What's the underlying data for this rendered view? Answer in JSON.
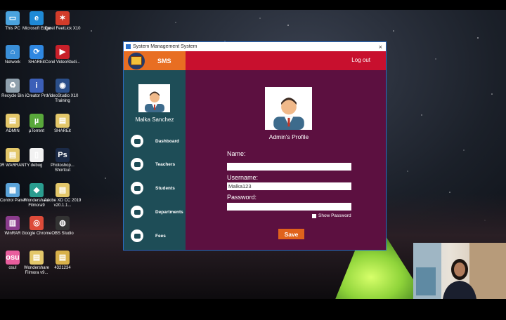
{
  "desktop_icons": [
    {
      "name": "this-pc",
      "label": "This PC",
      "color": "#4aa3df",
      "glyph": "▭"
    },
    {
      "name": "microsoft-edge",
      "label": "Microsoft Edge",
      "color": "#1f8ad6",
      "glyph": "e"
    },
    {
      "name": "corel-feetlick",
      "label": "Corel FeetLick X10",
      "color": "#d23c2a",
      "glyph": "✶"
    },
    {
      "name": "network",
      "label": "Network",
      "color": "#3a8fd8",
      "glyph": "⌂"
    },
    {
      "name": "shareit",
      "label": "SHAREit",
      "color": "#2f87e0",
      "glyph": "⟳"
    },
    {
      "name": "corel-videostudio",
      "label": "Corel VideoStudi...",
      "color": "#c8202a",
      "glyph": "▶"
    },
    {
      "name": "recycle-bin",
      "label": "Recycle Bin",
      "color": "#8fa0ad",
      "glyph": "♻"
    },
    {
      "name": "icreator-pro",
      "label": "iCreator Pro",
      "color": "#3c5fb8",
      "glyph": "i"
    },
    {
      "name": "videostudio-x10",
      "label": "VideoStudio X10 Training",
      "color": "#2b4f8a",
      "glyph": "◉"
    },
    {
      "name": "admin",
      "label": "ADMIN",
      "color": "#e3c76a",
      "glyph": "▤"
    },
    {
      "name": "utorrent",
      "label": "µTorrent",
      "color": "#59a83b",
      "glyph": "µ"
    },
    {
      "name": "shareit-folder",
      "label": "SHAREit",
      "color": "#e3c76a",
      "glyph": "▤"
    },
    {
      "name": "for-warranty",
      "label": "FOR WARRANTY",
      "color": "#e3c76a",
      "glyph": "▤"
    },
    {
      "name": "debug",
      "label": "debug",
      "color": "#f2f2f2",
      "glyph": "▯"
    },
    {
      "name": "photoshop",
      "label": "Photoshop... Shortcut",
      "color": "#1b2a47",
      "glyph": "Ps"
    },
    {
      "name": "control-panel",
      "label": "Control Panel",
      "color": "#5aa3d9",
      "glyph": "▦"
    },
    {
      "name": "wondershare-filmora9",
      "label": "Wondershare Filmora9",
      "color": "#2a9d8f",
      "glyph": "◆"
    },
    {
      "name": "adobe-xd",
      "label": "Adobe XD CC 2019 v20.1.1...",
      "color": "#e3c76a",
      "glyph": "▤"
    },
    {
      "name": "winrar",
      "label": "WinRAR",
      "color": "#8a3c8c",
      "glyph": "▥"
    },
    {
      "name": "google-chrome",
      "label": "Google Chrome",
      "color": "#dd4b39",
      "glyph": "◎"
    },
    {
      "name": "obs-studio",
      "label": "OBS Studio",
      "color": "#333333",
      "glyph": "◍"
    },
    {
      "name": "osu",
      "label": "osu!",
      "color": "#e95d9d",
      "glyph": "osu"
    },
    {
      "name": "wondershare-filmora-v9",
      "label": "Wondershare Filmora v9...",
      "color": "#e3c76a",
      "glyph": "▤"
    },
    {
      "name": "folder-4321234",
      "label": "4321234",
      "color": "#d8b04a",
      "glyph": "▤"
    }
  ],
  "window": {
    "title": "System Management System",
    "close_glyph": "×"
  },
  "sidebar": {
    "brand": "SMS",
    "user_name": "Malka Sanchez",
    "items": [
      {
        "label": "Dashboard"
      },
      {
        "label": "Teachers"
      },
      {
        "label": "Students"
      },
      {
        "label": "Departments"
      },
      {
        "label": "Fees"
      }
    ]
  },
  "topbar": {
    "logout_label": "Log out"
  },
  "profile": {
    "title": "Admin's Profile",
    "name_label": "Name:",
    "name_value": "",
    "username_label": "Username:",
    "username_value": "Malka123",
    "password_label": "Password:",
    "password_value": "",
    "show_password_label": "Show Password",
    "save_label": "Save"
  },
  "colors": {
    "sidebar": "#1e4d57",
    "brand": "#e86e22",
    "topbar": "#c8102e",
    "main": "#5c1040",
    "save": "#e0621c"
  }
}
